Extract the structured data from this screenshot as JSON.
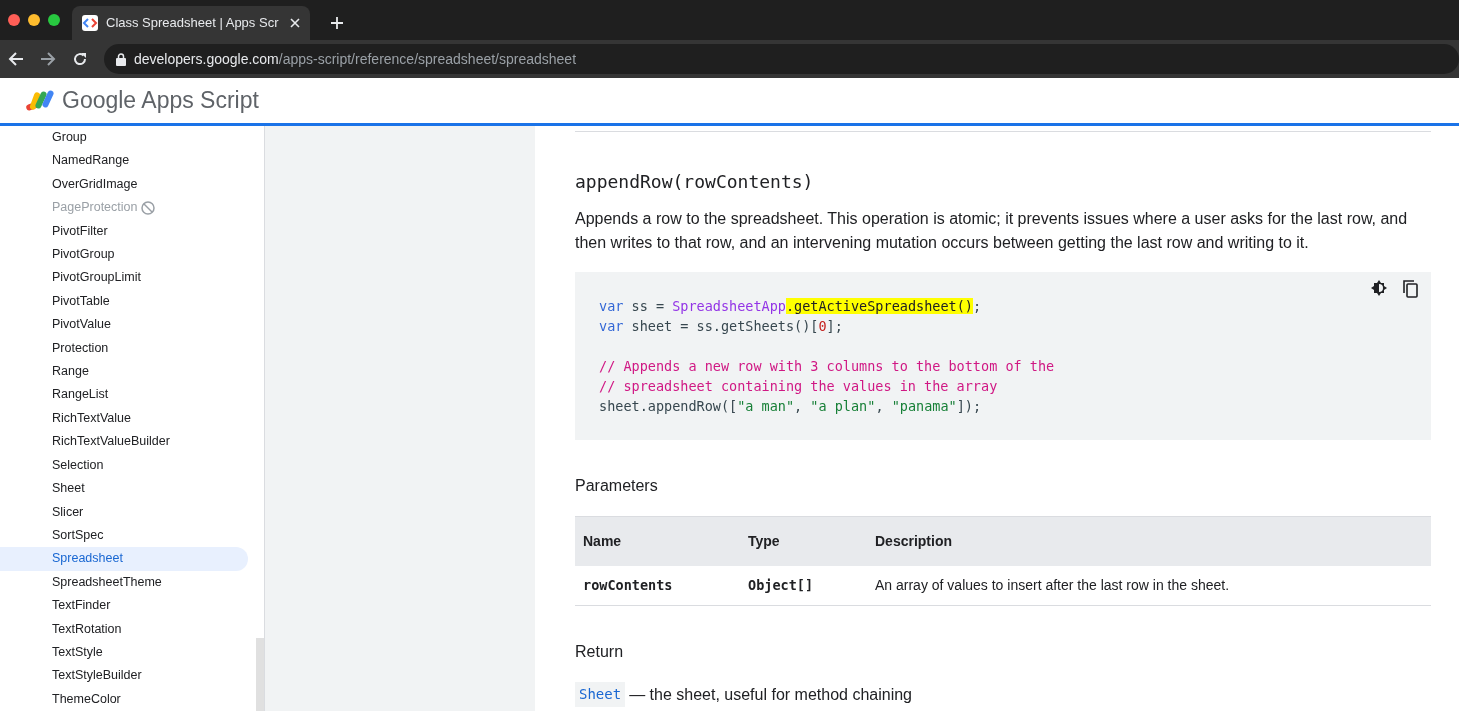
{
  "browser": {
    "tab_title": "Class Spreadsheet  |  Apps Scr",
    "url_host": "developers.google.com",
    "url_path": "/apps-script/reference/spreadsheet/spreadsheet"
  },
  "site": {
    "title_brand": "Google",
    "title_product": "Apps Script"
  },
  "sidebar": {
    "items": [
      {
        "label": "Group",
        "selected": false,
        "disabled": false
      },
      {
        "label": "NamedRange",
        "selected": false,
        "disabled": false
      },
      {
        "label": "OverGridImage",
        "selected": false,
        "disabled": false
      },
      {
        "label": "PageProtection",
        "selected": false,
        "disabled": true
      },
      {
        "label": "PivotFilter",
        "selected": false,
        "disabled": false
      },
      {
        "label": "PivotGroup",
        "selected": false,
        "disabled": false
      },
      {
        "label": "PivotGroupLimit",
        "selected": false,
        "disabled": false
      },
      {
        "label": "PivotTable",
        "selected": false,
        "disabled": false
      },
      {
        "label": "PivotValue",
        "selected": false,
        "disabled": false
      },
      {
        "label": "Protection",
        "selected": false,
        "disabled": false
      },
      {
        "label": "Range",
        "selected": false,
        "disabled": false
      },
      {
        "label": "RangeList",
        "selected": false,
        "disabled": false
      },
      {
        "label": "RichTextValue",
        "selected": false,
        "disabled": false
      },
      {
        "label": "RichTextValueBuilder",
        "selected": false,
        "disabled": false
      },
      {
        "label": "Selection",
        "selected": false,
        "disabled": false
      },
      {
        "label": "Sheet",
        "selected": false,
        "disabled": false
      },
      {
        "label": "Slicer",
        "selected": false,
        "disabled": false
      },
      {
        "label": "SortSpec",
        "selected": false,
        "disabled": false
      },
      {
        "label": "Spreadsheet",
        "selected": true,
        "disabled": false
      },
      {
        "label": "SpreadsheetTheme",
        "selected": false,
        "disabled": false
      },
      {
        "label": "TextFinder",
        "selected": false,
        "disabled": false
      },
      {
        "label": "TextRotation",
        "selected": false,
        "disabled": false
      },
      {
        "label": "TextStyle",
        "selected": false,
        "disabled": false
      },
      {
        "label": "TextStyleBuilder",
        "selected": false,
        "disabled": false
      },
      {
        "label": "ThemeColor",
        "selected": false,
        "disabled": false
      }
    ]
  },
  "method": {
    "signature": "appendRow(rowContents)",
    "description": "Appends a row to the spreadsheet. This operation is atomic; it prevents issues where a user asks for the last row, and then writes to that row, and an intervening mutation occurs between getting the last row and writing to it.",
    "code": [
      {
        "kind": "code",
        "tokens": [
          {
            "kind": "keyword",
            "text": "var"
          },
          {
            "kind": "plain",
            "text": " ss = "
          },
          {
            "kind": "class",
            "text": "SpreadsheetApp"
          },
          {
            "kind": "highlight",
            "text": ".getActiveSpreadsheet()"
          },
          {
            "kind": "plain",
            "text": ";"
          }
        ]
      },
      {
        "kind": "code",
        "tokens": [
          {
            "kind": "keyword",
            "text": "var"
          },
          {
            "kind": "plain",
            "text": " sheet = ss.getSheets()["
          },
          {
            "kind": "number",
            "text": "0"
          },
          {
            "kind": "plain",
            "text": "];"
          }
        ]
      },
      {
        "kind": "blank"
      },
      {
        "kind": "code",
        "tokens": [
          {
            "kind": "comment",
            "text": "// Appends a new row with 3 columns to the bottom of the"
          }
        ]
      },
      {
        "kind": "code",
        "tokens": [
          {
            "kind": "comment",
            "text": "// spreadsheet containing the values in the array"
          }
        ]
      },
      {
        "kind": "code",
        "tokens": [
          {
            "kind": "plain",
            "text": "sheet.appendRow(["
          },
          {
            "kind": "string",
            "text": "\"a man\""
          },
          {
            "kind": "plain",
            "text": ", "
          },
          {
            "kind": "string",
            "text": "\"a plan\""
          },
          {
            "kind": "plain",
            "text": ", "
          },
          {
            "kind": "string",
            "text": "\"panama\""
          },
          {
            "kind": "plain",
            "text": "]);"
          }
        ]
      }
    ],
    "parameters_heading": "Parameters",
    "parameters_table": {
      "columns": [
        "Name",
        "Type",
        "Description"
      ],
      "rows": [
        [
          "rowContents",
          "Object[]",
          "An array of values to insert after the last row in the sheet."
        ]
      ]
    },
    "return_heading": "Return",
    "return_type": "Sheet",
    "return_text": "— the sheet, useful for method chaining"
  }
}
